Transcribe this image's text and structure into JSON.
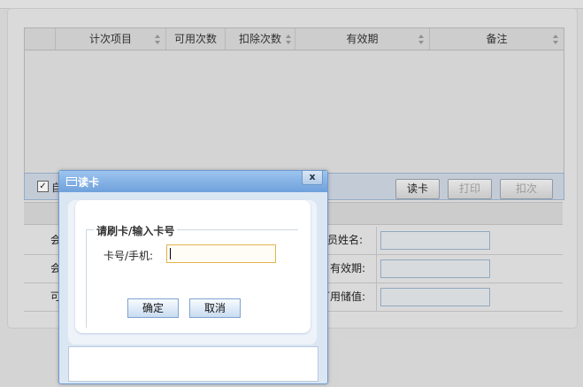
{
  "grid": {
    "columns": [
      "计次项目",
      "可用次数",
      "扣除次数",
      "有效期",
      "备注"
    ]
  },
  "toolbar": {
    "auto_label": "自动",
    "read_card": "读卡",
    "print": "打印",
    "deduct": "扣次"
  },
  "form": {
    "left_labels": [
      "会",
      "会",
      "可"
    ],
    "right_labels": [
      "员姓名:",
      "有效期:",
      "可用储值:"
    ]
  },
  "dialog": {
    "title": "读卡",
    "close_glyph": "x",
    "legend": "请刷卡/输入卡号",
    "card_label": "卡号/手机:",
    "card_value": "",
    "ok": "确定",
    "cancel": "取消"
  }
}
